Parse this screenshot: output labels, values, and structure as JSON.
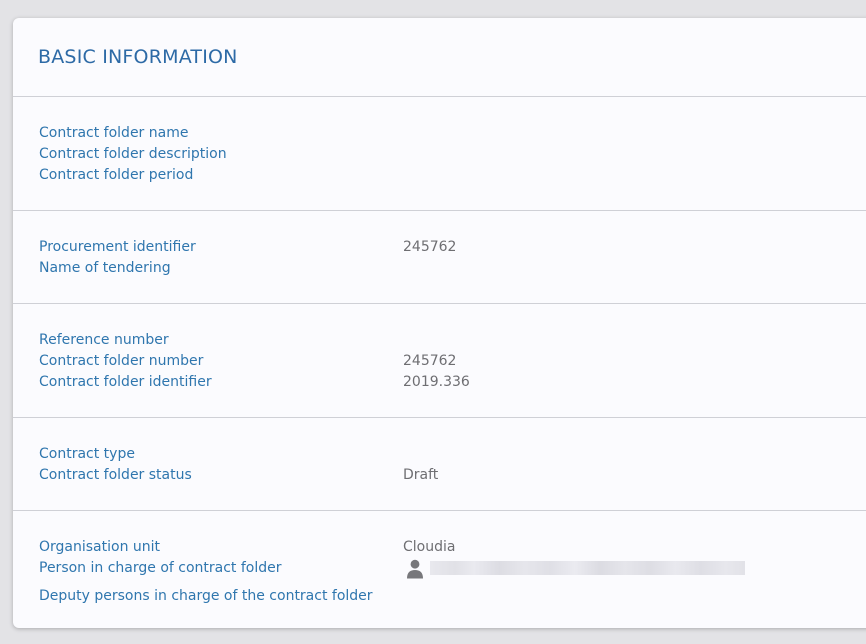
{
  "card": {
    "title": "BASIC INFORMATION"
  },
  "sections": [
    {
      "rows": [
        {
          "label": "Contract folder name",
          "value": ""
        },
        {
          "label": "Contract folder description",
          "value": ""
        },
        {
          "label": "Contract folder period",
          "value": ""
        }
      ]
    },
    {
      "rows": [
        {
          "label": "Procurement identifier",
          "value": "245762"
        },
        {
          "label": "Name of tendering",
          "value": ""
        }
      ]
    },
    {
      "rows": [
        {
          "label": "Reference number",
          "value": ""
        },
        {
          "label": "Contract folder number",
          "value": "245762"
        },
        {
          "label": "Contract folder identifier",
          "value": "2019.336"
        }
      ]
    },
    {
      "rows": [
        {
          "label": "Contract type",
          "value": ""
        },
        {
          "label": "Contract folder status",
          "value": "Draft"
        }
      ]
    },
    {
      "rows": [
        {
          "label": "Organisation unit",
          "value": "Cloudia"
        },
        {
          "label": "Person in charge of contract folder",
          "value": "",
          "icon": "person-icon"
        },
        {
          "label": "Deputy persons in charge of the contract folder",
          "value": ""
        }
      ]
    }
  ],
  "colors": {
    "label": "#2f76ae",
    "title": "#2d6aa6",
    "value": "#6e6e72",
    "divider": "#cfd0d6",
    "card_background": "#fbfbfe"
  }
}
